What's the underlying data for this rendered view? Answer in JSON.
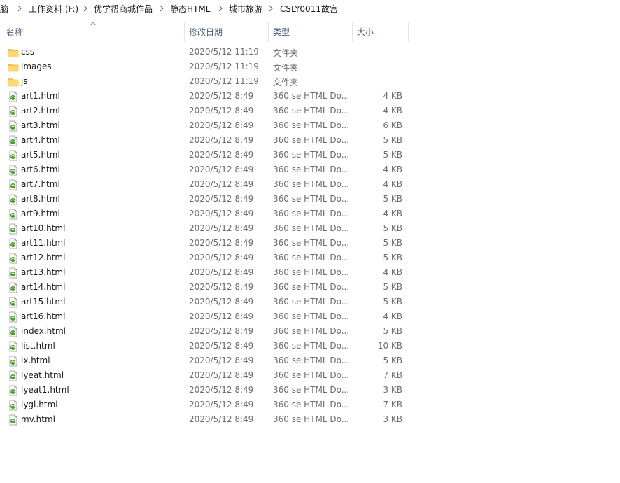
{
  "breadcrumb": [
    {
      "label": "电脑"
    },
    {
      "label": "工作资料 (F:)"
    },
    {
      "label": "优学帮商城作品"
    },
    {
      "label": "静态HTML"
    },
    {
      "label": "城市旅游"
    },
    {
      "label": "CSLY0011故宫"
    }
  ],
  "columns": {
    "name": "名称",
    "date": "修改日期",
    "type": "类型",
    "size": "大小"
  },
  "colors": {
    "folder": "#f5c552",
    "header_text": "#4c607a",
    "meta_text": "#6d6d6d",
    "html_icon": "#4aa02c"
  },
  "files": [
    {
      "name": "css",
      "date": "2020/5/12 11:19",
      "type": "文件夹",
      "size": "",
      "icon": "folder-icon"
    },
    {
      "name": "images",
      "date": "2020/5/12 11:19",
      "type": "文件夹",
      "size": "",
      "icon": "folder-icon"
    },
    {
      "name": "js",
      "date": "2020/5/12 11:19",
      "type": "文件夹",
      "size": "",
      "icon": "folder-icon"
    },
    {
      "name": "art1.html",
      "date": "2020/5/12 8:49",
      "type": "360 se HTML Do...",
      "size": "4 KB",
      "icon": "html-file-icon"
    },
    {
      "name": "art2.html",
      "date": "2020/5/12 8:49",
      "type": "360 se HTML Do...",
      "size": "4 KB",
      "icon": "html-file-icon"
    },
    {
      "name": "art3.html",
      "date": "2020/5/12 8:49",
      "type": "360 se HTML Do...",
      "size": "6 KB",
      "icon": "html-file-icon"
    },
    {
      "name": "art4.html",
      "date": "2020/5/12 8:49",
      "type": "360 se HTML Do...",
      "size": "5 KB",
      "icon": "html-file-icon"
    },
    {
      "name": "art5.html",
      "date": "2020/5/12 8:49",
      "type": "360 se HTML Do...",
      "size": "5 KB",
      "icon": "html-file-icon"
    },
    {
      "name": "art6.html",
      "date": "2020/5/12 8:49",
      "type": "360 se HTML Do...",
      "size": "4 KB",
      "icon": "html-file-icon"
    },
    {
      "name": "art7.html",
      "date": "2020/5/12 8:49",
      "type": "360 se HTML Do...",
      "size": "4 KB",
      "icon": "html-file-icon"
    },
    {
      "name": "art8.html",
      "date": "2020/5/12 8:49",
      "type": "360 se HTML Do...",
      "size": "5 KB",
      "icon": "html-file-icon"
    },
    {
      "name": "art9.html",
      "date": "2020/5/12 8:49",
      "type": "360 se HTML Do...",
      "size": "4 KB",
      "icon": "html-file-icon"
    },
    {
      "name": "art10.html",
      "date": "2020/5/12 8:49",
      "type": "360 se HTML Do...",
      "size": "5 KB",
      "icon": "html-file-icon"
    },
    {
      "name": "art11.html",
      "date": "2020/5/12 8:49",
      "type": "360 se HTML Do...",
      "size": "5 KB",
      "icon": "html-file-icon"
    },
    {
      "name": "art12.html",
      "date": "2020/5/12 8:49",
      "type": "360 se HTML Do...",
      "size": "5 KB",
      "icon": "html-file-icon"
    },
    {
      "name": "art13.html",
      "date": "2020/5/12 8:49",
      "type": "360 se HTML Do...",
      "size": "4 KB",
      "icon": "html-file-icon"
    },
    {
      "name": "art14.html",
      "date": "2020/5/12 8:49",
      "type": "360 se HTML Do...",
      "size": "5 KB",
      "icon": "html-file-icon"
    },
    {
      "name": "art15.html",
      "date": "2020/5/12 8:49",
      "type": "360 se HTML Do...",
      "size": "5 KB",
      "icon": "html-file-icon"
    },
    {
      "name": "art16.html",
      "date": "2020/5/12 8:49",
      "type": "360 se HTML Do...",
      "size": "4 KB",
      "icon": "html-file-icon"
    },
    {
      "name": "index.html",
      "date": "2020/5/12 8:49",
      "type": "360 se HTML Do...",
      "size": "5 KB",
      "icon": "html-file-icon"
    },
    {
      "name": "list.html",
      "date": "2020/5/12 8:49",
      "type": "360 se HTML Do...",
      "size": "10 KB",
      "icon": "html-file-icon"
    },
    {
      "name": "lx.html",
      "date": "2020/5/12 8:49",
      "type": "360 se HTML Do...",
      "size": "5 KB",
      "icon": "html-file-icon"
    },
    {
      "name": "lyeat.html",
      "date": "2020/5/12 8:49",
      "type": "360 se HTML Do...",
      "size": "7 KB",
      "icon": "html-file-icon"
    },
    {
      "name": "lyeat1.html",
      "date": "2020/5/12 8:49",
      "type": "360 se HTML Do...",
      "size": "3 KB",
      "icon": "html-file-icon"
    },
    {
      "name": "lygl.html",
      "date": "2020/5/12 8:49",
      "type": "360 se HTML Do...",
      "size": "7 KB",
      "icon": "html-file-icon"
    },
    {
      "name": "mv.html",
      "date": "2020/5/12 8:49",
      "type": "360 se HTML Do...",
      "size": "3 KB",
      "icon": "html-file-icon"
    }
  ]
}
